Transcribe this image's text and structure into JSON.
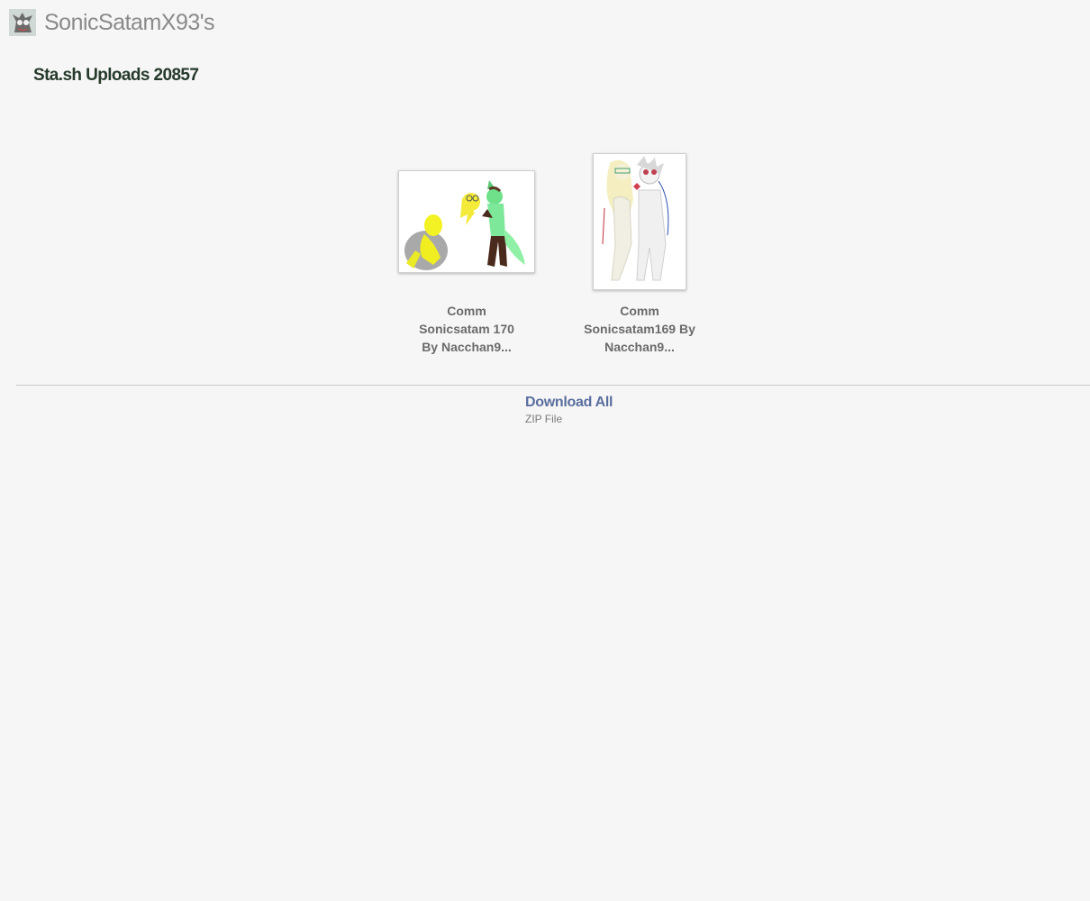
{
  "header": {
    "username": "SonicSatamX93's",
    "avatar_icon": "user-avatar"
  },
  "page": {
    "title": "Sta.sh Uploads 20857"
  },
  "items": [
    {
      "title_lines": [
        "Comm",
        "Sonicsatam 170",
        "By Nacchan9..."
      ],
      "thumb_icon": "artwork-thumbnail"
    },
    {
      "title_lines": [
        "Comm",
        "Sonicsatam169 By",
        "Nacchan9..."
      ],
      "thumb_icon": "artwork-thumbnail"
    }
  ],
  "download": {
    "label": "Download All",
    "sublabel": "ZIP File"
  },
  "colors": {
    "background": "#f6f6f6",
    "title": "#263a2c",
    "link": "#5a6e9e",
    "username": "#8a8a8a"
  }
}
